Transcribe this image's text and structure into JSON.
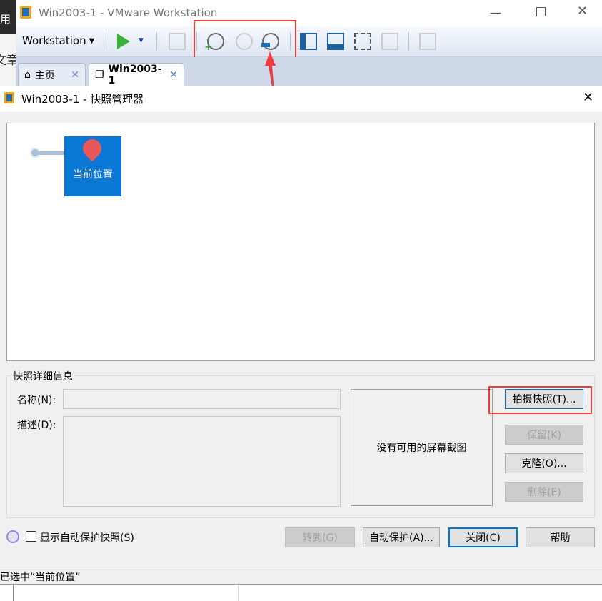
{
  "app": {
    "title": "Win2003-1 - VMware Workstation",
    "menu_label": "Workstation",
    "side_text_1": "用",
    "side_text_2": "文章"
  },
  "tabs": [
    {
      "label": "主页"
    },
    {
      "label": "Win2003-1"
    }
  ],
  "dialog": {
    "title": "Win2003-1 - 快照管理器",
    "tree_node": "当前位置",
    "group_title": "快照详细信息",
    "name_label": "名称(N):",
    "name_value": "",
    "desc_label": "描述(D):",
    "desc_value": "",
    "no_screenshot": "没有可用的屏幕截图",
    "buttons": {
      "take": "拍摄快照(T)...",
      "keep": "保留(K)",
      "clone": "克隆(O)...",
      "delete": "删除(E)",
      "goto": "转到(G)",
      "autoprotect": "自动保护(A)...",
      "close": "关闭(C)",
      "help": "帮助"
    },
    "show_autoprotect": "显示自动保护快照(S)",
    "show_autoprotect_checked": false,
    "status": "已选中“当前位置”"
  },
  "colors": {
    "accent": "#0078d7",
    "highlight": "#f03c3c",
    "node_bg": "#0a78d4"
  }
}
